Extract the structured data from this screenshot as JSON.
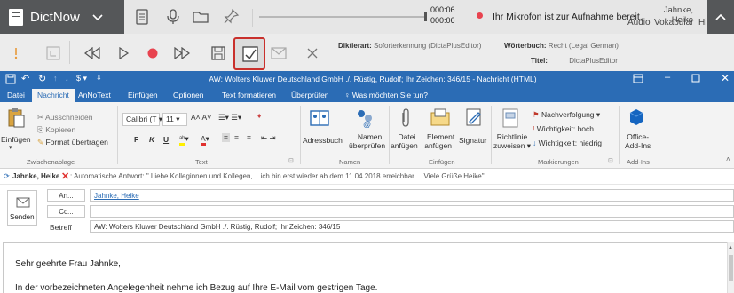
{
  "dictnow": {
    "app_name": "DictNow",
    "time_current": "000:06",
    "time_total": "000:06",
    "status": "Ihr Mikrofon ist zur Aufnahme bereit.",
    "audio_label": "Audio",
    "user_name": "Jahnke, Heike",
    "menu_vokabular": "Vokabular",
    "menu_hilfe": "Hilfe",
    "diktierart_label": "Diktierart:",
    "diktierart_value": "Soforterkennung (DictaPlusEditor)",
    "woerterbuch_label": "Wörterbuch:",
    "woerterbuch_value": "Recht (Legal German)",
    "titel_label": "Titel:",
    "titel_value": "DictaPlusEditor",
    "accent_dark": "#555759",
    "highlight_color": "#c9302c",
    "record_color": "#e8434f"
  },
  "outlook": {
    "window_title": "AW: Wolters Kluwer Deutschland GmbH ./. Rüstig, Rudolf; Ihr Zeichen: 346/15 - Nachricht (HTML)",
    "brand_color": "#2b6cb5",
    "tabs": [
      "Datei",
      "Nachricht",
      "AnNoText",
      "Einfügen",
      "Optionen",
      "Text formatieren",
      "Überprüfen"
    ],
    "tell_me": "Was möchten Sie tun?",
    "ribbon": {
      "einfuegen": "Einfügen",
      "ausschneiden": "Ausschneiden",
      "kopieren": "Kopieren",
      "format_uebertragen": "Format übertragen",
      "group_clipboard": "Zwischenablage",
      "font_name": "Calibri (T",
      "font_size": "11",
      "bold": "F",
      "italic": "K",
      "underline": "U",
      "group_text": "Text",
      "adressbuch": "Adressbuch",
      "namen_ueberpruefen_1": "Namen",
      "namen_ueberpruefen_2": "überprüfen",
      "group_namen": "Namen",
      "datei_anfuegen_1": "Datei",
      "datei_anfuegen_2": "anfügen",
      "element_anfuegen_1": "Element",
      "element_anfuegen_2": "anfügen",
      "signatur": "Signatur",
      "group_einfuegen": "Einfügen",
      "richtlinie_1": "Richtlinie",
      "richtlinie_2": "zuweisen",
      "nachverfolgung": "Nachverfolgung",
      "wichtigkeit_hoch": "Wichtigkeit: hoch",
      "wichtigkeit_niedrig": "Wichtigkeit: niedrig",
      "group_markierungen": "Markierungen",
      "office_addins_1": "Office-",
      "office_addins_2": "Add-Ins",
      "group_addins": "Add-Ins"
    },
    "info_sender": "Jahnke, Heike",
    "info_text": ": Automatische Antwort: \" Liebe Kolleginnen und Kollegen,    ich bin erst wieder ab dem 11.04.2018 erreichbar.    Viele Grüße Heike\"",
    "send_label": "Senden",
    "to_label": "An...",
    "to_value": "Jahnke, Heike",
    "cc_label": "Cc...",
    "cc_value": "",
    "subject_label": "Betreff",
    "subject_value": "AW: Wolters Kluwer Deutschland GmbH ./. Rüstig, Rudolf; Ihr Zeichen: 346/15",
    "body_greeting": "Sehr geehrte Frau Jahnke,",
    "body_line1": "In der vorbezeichneten Angelegenheit nehme ich Bezug auf Ihre E-Mail vom gestrigen Tage."
  }
}
